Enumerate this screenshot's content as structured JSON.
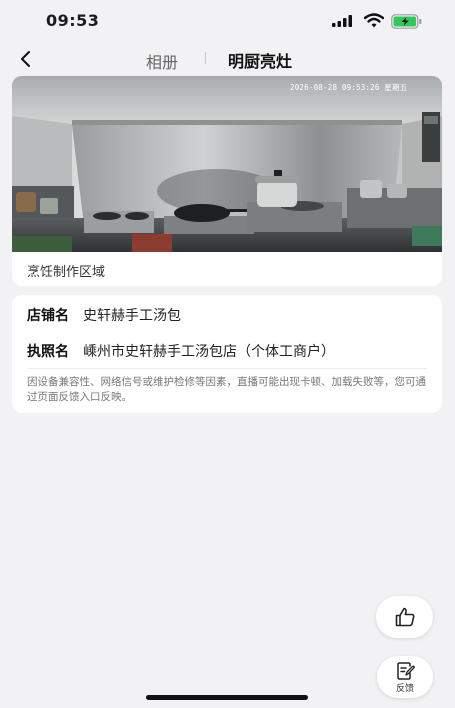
{
  "status_bar": {
    "time": "09:53",
    "battery_color": "#34c759"
  },
  "nav": {
    "back_icon": "chevron-left-icon",
    "tab_album": "相册",
    "tab_kitchen": "明厨亮灶"
  },
  "video": {
    "timestamp": "2026-08-28 09:53:26 星期五",
    "caption": "烹饪制作区域"
  },
  "shop_info": {
    "name_label": "店铺名",
    "name_value": "史轩赫手工汤包",
    "license_label": "执照名",
    "license_value": "嵊州市史轩赫手工汤包店（个体工商户）",
    "notice": "因设备兼容性、网络信号或维护检修等因素，直播可能出现卡顿、加载失败等，您可通过页面反馈入口反映。"
  },
  "actions": {
    "like_icon": "thumbs-up-icon",
    "feedback_icon": "feedback-icon",
    "feedback_label": "反馈"
  }
}
